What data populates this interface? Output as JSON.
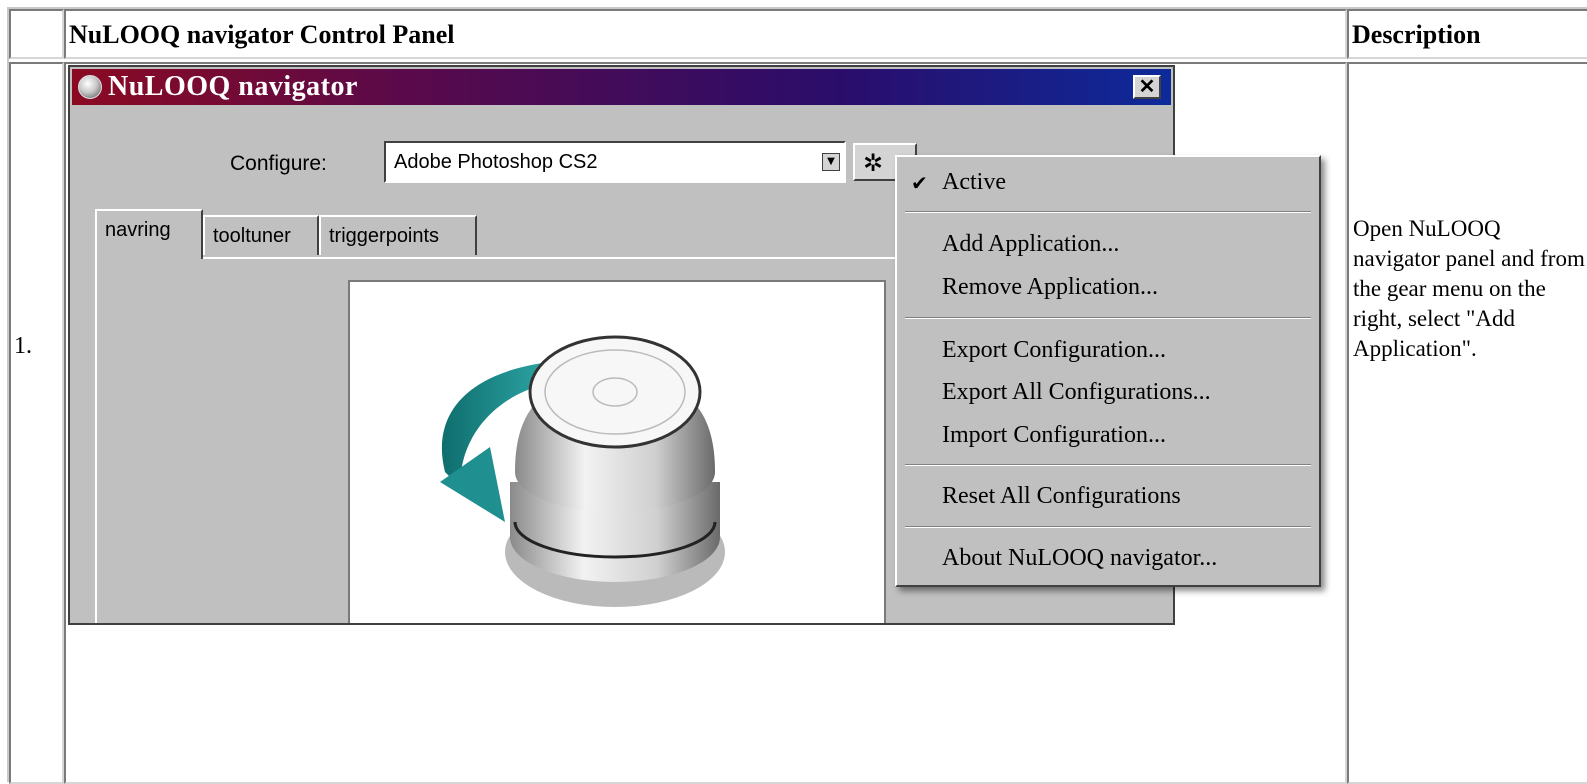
{
  "table": {
    "header_screenshot": "NuLOOQ navigator Control Panel",
    "header_description": "Description",
    "row_number": "1.",
    "description": "Open NuLOOQ navigator panel and from the gear menu on the right, select \"Add Application\"."
  },
  "window": {
    "title": "NuLOOQ navigator",
    "close_glyph": "✕",
    "configure_label": "Configure:",
    "configure_value": "Adobe Photoshop CS2",
    "combo_arrow_glyph": "▼",
    "gear_glyph": "✲",
    "tabs": [
      {
        "label": "navring",
        "active": true
      },
      {
        "label": "tooltuner",
        "active": false
      },
      {
        "label": "triggerpoints",
        "active": false
      }
    ]
  },
  "menu": {
    "check_glyph": "✔",
    "items": {
      "active": "Active",
      "add_application": "Add Application...",
      "remove_application": "Remove Application...",
      "export_configuration": "Export Configuration...",
      "export_all": "Export All Configurations...",
      "import_configuration": "Import Configuration...",
      "reset_all": "Reset All Configurations",
      "about": "About NuLOOQ navigator..."
    }
  },
  "colors": {
    "titlebar_start": "#8b0a22",
    "titlebar_end": "#0d2a9a",
    "window_face": "#c0c0c0",
    "arrow_teal": "#1a8a8a"
  },
  "icons": [
    "navigator-device-icon",
    "close-icon",
    "gear-icon",
    "dropdown-arrow-icon",
    "checkmark-icon"
  ]
}
